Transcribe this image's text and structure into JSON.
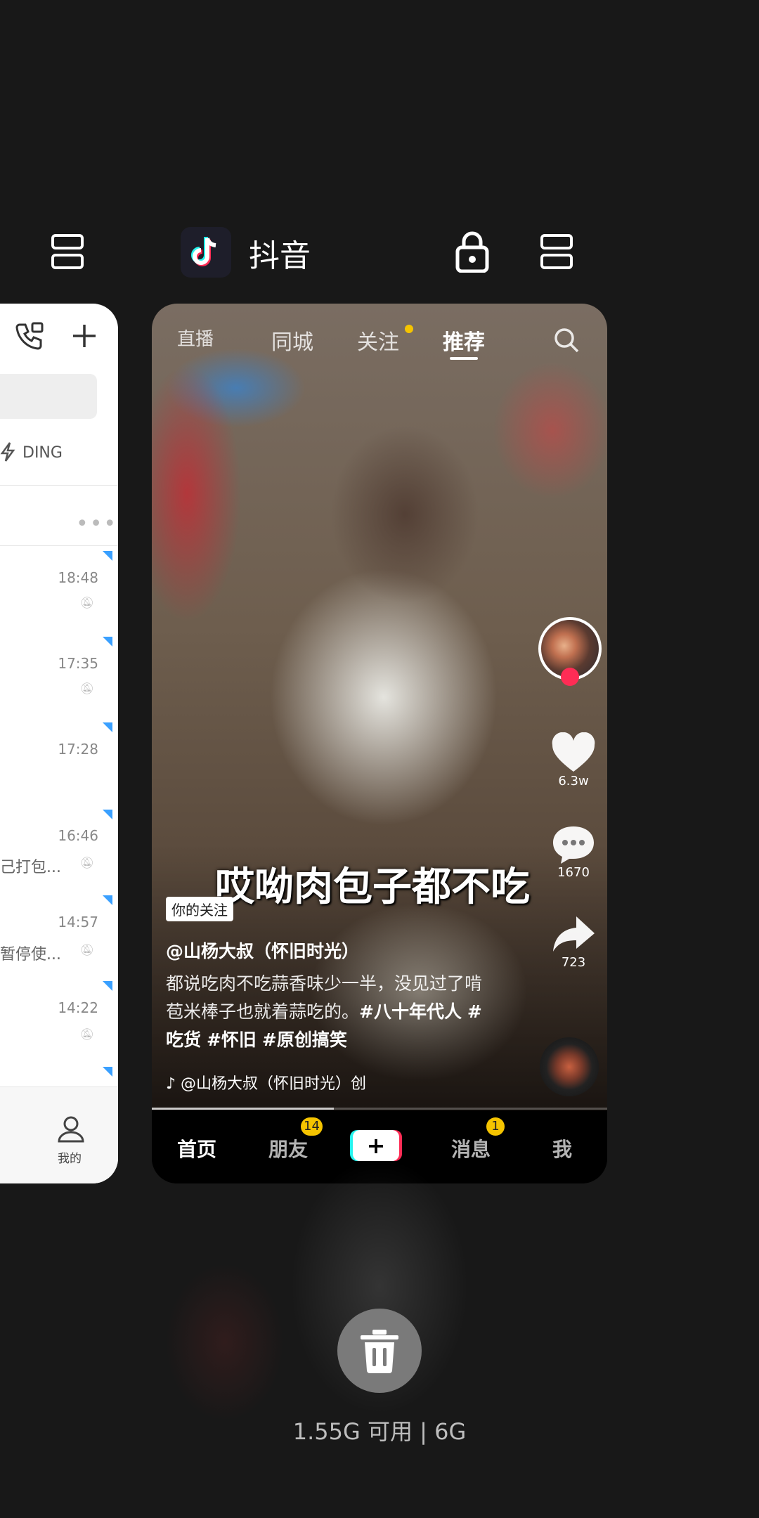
{
  "header": {
    "app_title": "抖音"
  },
  "left_card": {
    "search_placeholder": "",
    "ding_label": "DING",
    "times": [
      "18:48",
      "17:35",
      "17:28",
      "16:46",
      "14:57",
      "14:22"
    ],
    "snippets": [
      "己打包...",
      "暂停使..."
    ],
    "bottom_nav_label": "我的"
  },
  "douyin": {
    "top_nav": {
      "live": "直播",
      "local": "同城",
      "following": "关注",
      "recommend": "推荐"
    },
    "video": {
      "caption": "哎呦肉包子都不吃",
      "follow_tag": "你的关注",
      "author": "@山杨大叔（怀旧时光）",
      "desc_plain": "都说吃肉不吃蒜香味少一半，没见过了啃苞米棒子也就着蒜吃的。",
      "hashtags": [
        "#八十年代人",
        "#吃货",
        "#怀旧",
        "#原创搞笑"
      ],
      "music": "@山杨大叔（怀旧时光）创",
      "likes": "6.3w",
      "comments": "1670",
      "shares": "723"
    },
    "tabs": {
      "home": "首页",
      "friends": "朋友",
      "friends_badge": "14",
      "plus": "+",
      "messages": "消息",
      "messages_badge": "1",
      "me": "我"
    }
  },
  "footer": {
    "memory": "1.55G 可用 | 6G"
  },
  "colors": {
    "background": "#181818",
    "badge": "#f5c400",
    "tiktok_red": "#fe2c55",
    "tiktok_cyan": "#25f4ee",
    "unread_triangle": "#3aa0ff"
  }
}
